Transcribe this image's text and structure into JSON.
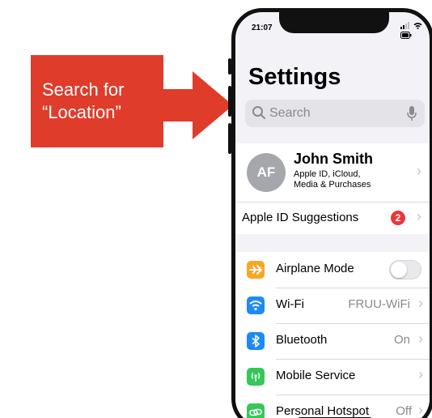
{
  "callout": {
    "line1": "Search for",
    "line2": "“Location”",
    "color": "#df3c2b"
  },
  "status_bar": {
    "time": "21:07",
    "icons": [
      "signal-icon",
      "wifi-icon",
      "battery-icon"
    ]
  },
  "page": {
    "title": "Settings"
  },
  "search": {
    "placeholder": "Search"
  },
  "profile": {
    "initials": "AF",
    "name": "John Smith",
    "subtitle_line1": "Apple ID, iCloud,",
    "subtitle_line2": "Media & Purchases"
  },
  "suggestions": {
    "label": "Apple ID Suggestions",
    "badge_count": "2"
  },
  "settings_rows": [
    {
      "label": "Airplane Mode",
      "value": "",
      "icon": "airplane-icon",
      "icon_color": "#f7a724",
      "control": "toggle",
      "toggle_on": false
    },
    {
      "label": "Wi-Fi",
      "value": "FRUU-WiFi",
      "icon": "wifi-icon",
      "icon_color": "#1d8af5",
      "control": "chevron"
    },
    {
      "label": "Bluetooth",
      "value": "On",
      "icon": "bluetooth-icon",
      "icon_color": "#1d8af5",
      "control": "chevron"
    },
    {
      "label": "Mobile Service",
      "value": "",
      "icon": "antenna-icon",
      "icon_color": "#35c759",
      "control": "chevron"
    },
    {
      "label": "Personal Hotspot",
      "value": "Off",
      "icon": "link-icon",
      "icon_color": "#35c759",
      "control": "chevron"
    }
  ]
}
